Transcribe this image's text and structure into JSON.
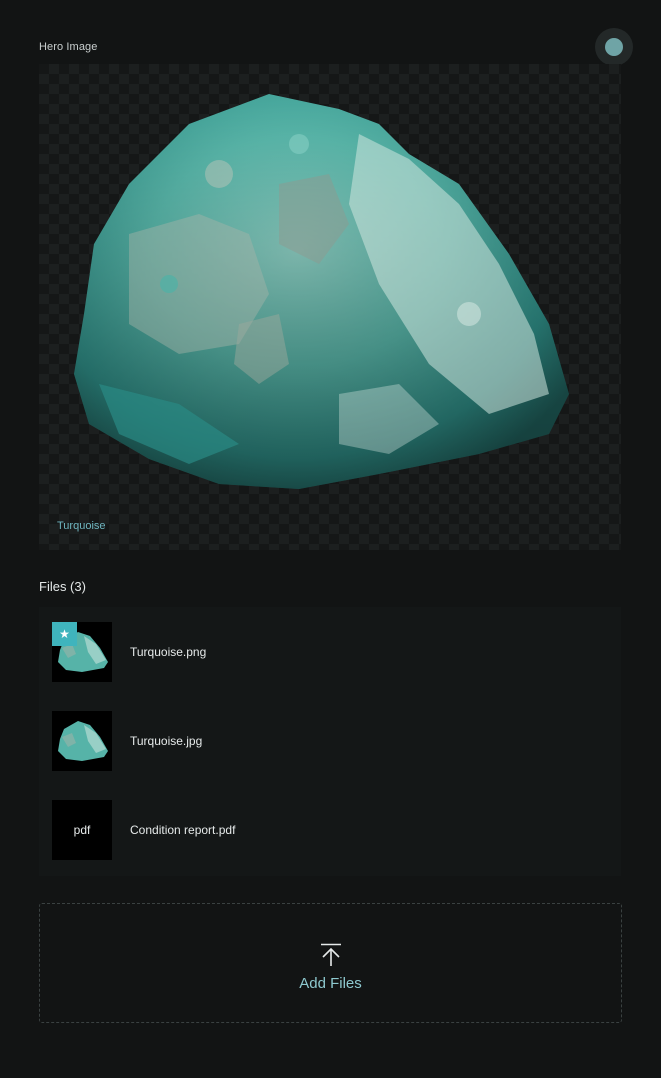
{
  "hero": {
    "label": "Hero Image",
    "caption": "Turquoise",
    "status_color": "#6fa4a6"
  },
  "files": {
    "heading": "Files (3)",
    "items": [
      {
        "name": "Turquoise.png",
        "thumbnail": "turquoise-image",
        "primary": true,
        "badge_icon": "star-icon",
        "badge_glyph": "★"
      },
      {
        "name": "Turquoise.jpg",
        "thumbnail": "turquoise-image",
        "primary": false
      },
      {
        "name": "Condition report.pdf",
        "thumbnail": "pdf-document",
        "thumb_label": "pdf",
        "primary": false
      }
    ]
  },
  "upload": {
    "label": "Add Files",
    "icon": "upload-arrow-icon"
  },
  "colors": {
    "background": "#121414",
    "accent": "#3fb4bd",
    "accent_text": "#8ec9cf",
    "caption_text": "#6fb6c0"
  }
}
